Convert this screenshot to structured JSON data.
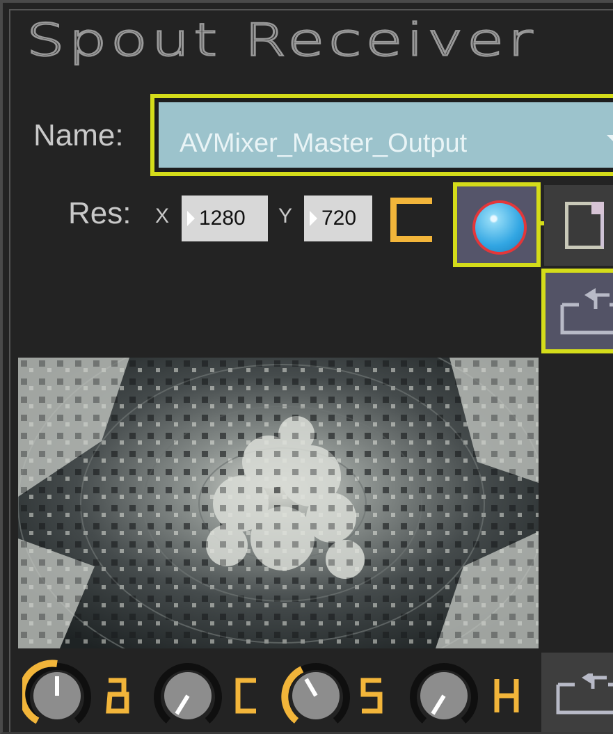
{
  "app": {
    "title": "Spout Receiver"
  },
  "name_row": {
    "label": "Name:",
    "selected": "AVMixer_Master_Output"
  },
  "res_row": {
    "label": "Res:",
    "x_label": "X",
    "x_value": "1280",
    "y_label": "Y",
    "y_value": "720"
  },
  "icons": {
    "record": "record-circle-icon",
    "file": "document-icon",
    "swap": "swap-arrow-icon",
    "bracket": "bracket-icon"
  },
  "knobs": [
    {
      "letter": "B",
      "name": "brightness-knob"
    },
    {
      "letter": "C",
      "name": "contrast-knob"
    },
    {
      "letter": "S",
      "name": "saturation-knob"
    },
    {
      "letter": "H",
      "name": "hue-knob"
    }
  ],
  "colors": {
    "highlight": "#d4dc1a",
    "accent": "#f2b53a",
    "dropdown_bg": "#9cc3cc",
    "record": "#32a6e3"
  }
}
